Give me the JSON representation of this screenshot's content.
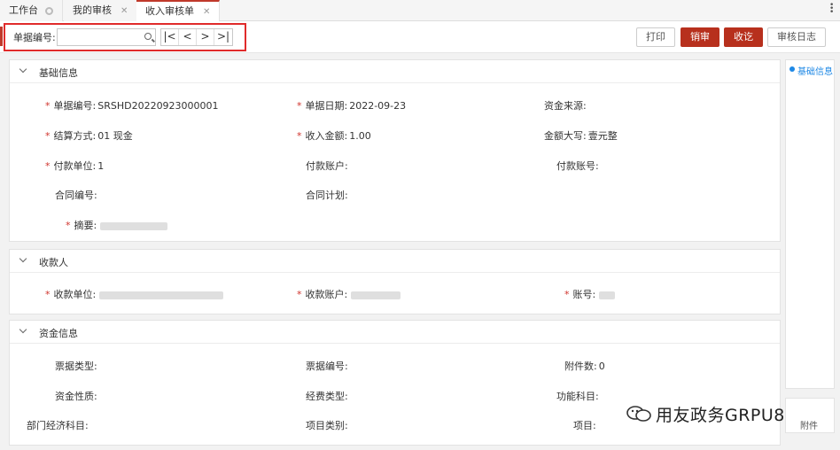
{
  "tabs": [
    {
      "label": "工作台"
    },
    {
      "label": "我的审核"
    },
    {
      "label": "收入审核单"
    }
  ],
  "toolbar": {
    "doc_no_label": "单据编号:",
    "doc_no_value": "",
    "nav": [
      "|<",
      "<",
      ">",
      ">|"
    ],
    "print": "打印",
    "cancel_audit": "销审",
    "receive": "收讫",
    "audit_log": "审核日志"
  },
  "sections": {
    "basic": {
      "title": "基础信息",
      "doc_no": {
        "label": "单据编号:",
        "value": "SRSHD20220923000001"
      },
      "doc_date": {
        "label": "单据日期:",
        "value": "2022-09-23"
      },
      "fund_source": {
        "label": "资金来源:",
        "value": ""
      },
      "settle": {
        "label": "结算方式:",
        "value": "01 现金"
      },
      "amount": {
        "label": "收入金额:",
        "value": "1.00"
      },
      "amount_upper": {
        "label": "金额大写:",
        "value": "壹元整"
      },
      "payer": {
        "label": "付款单位:",
        "value": "1"
      },
      "payer_account": {
        "label": "付款账户:",
        "value": ""
      },
      "payer_no": {
        "label": "付款账号:",
        "value": ""
      },
      "contract_no": {
        "label": "合同编号:",
        "value": ""
      },
      "contract_plan": {
        "label": "合同计划:",
        "value": ""
      },
      "summary": {
        "label": "摘要:",
        "value": ""
      }
    },
    "payee": {
      "title": "收款人",
      "unit": {
        "label": "收款单位:"
      },
      "account": {
        "label": "收款账户:"
      },
      "acct_no": {
        "label": "账号:"
      }
    },
    "fund": {
      "title": "资金信息",
      "bill_type": {
        "label": "票据类型:",
        "value": ""
      },
      "bill_no": {
        "label": "票据编号:",
        "value": ""
      },
      "attach_count": {
        "label": "附件数:",
        "value": "0"
      },
      "fund_nature": {
        "label": "资金性质:",
        "value": ""
      },
      "expense_type": {
        "label": "经费类型:",
        "value": ""
      },
      "func_subject": {
        "label": "功能科目:",
        "value": ""
      },
      "dept_econ": {
        "label": "部门经济科目:",
        "value": ""
      },
      "project_type": {
        "label": "项目类别:",
        "value": ""
      },
      "project": {
        "label": "项目:",
        "value": ""
      }
    }
  },
  "sidenav": {
    "item": "基础信息",
    "attach": "附件"
  },
  "watermark": "用友政务GRPU8",
  "colors": {
    "accent": "#b7301d",
    "highlight_box": "#e02b2b",
    "link": "#1e88e5",
    "required": "#d0332c"
  }
}
